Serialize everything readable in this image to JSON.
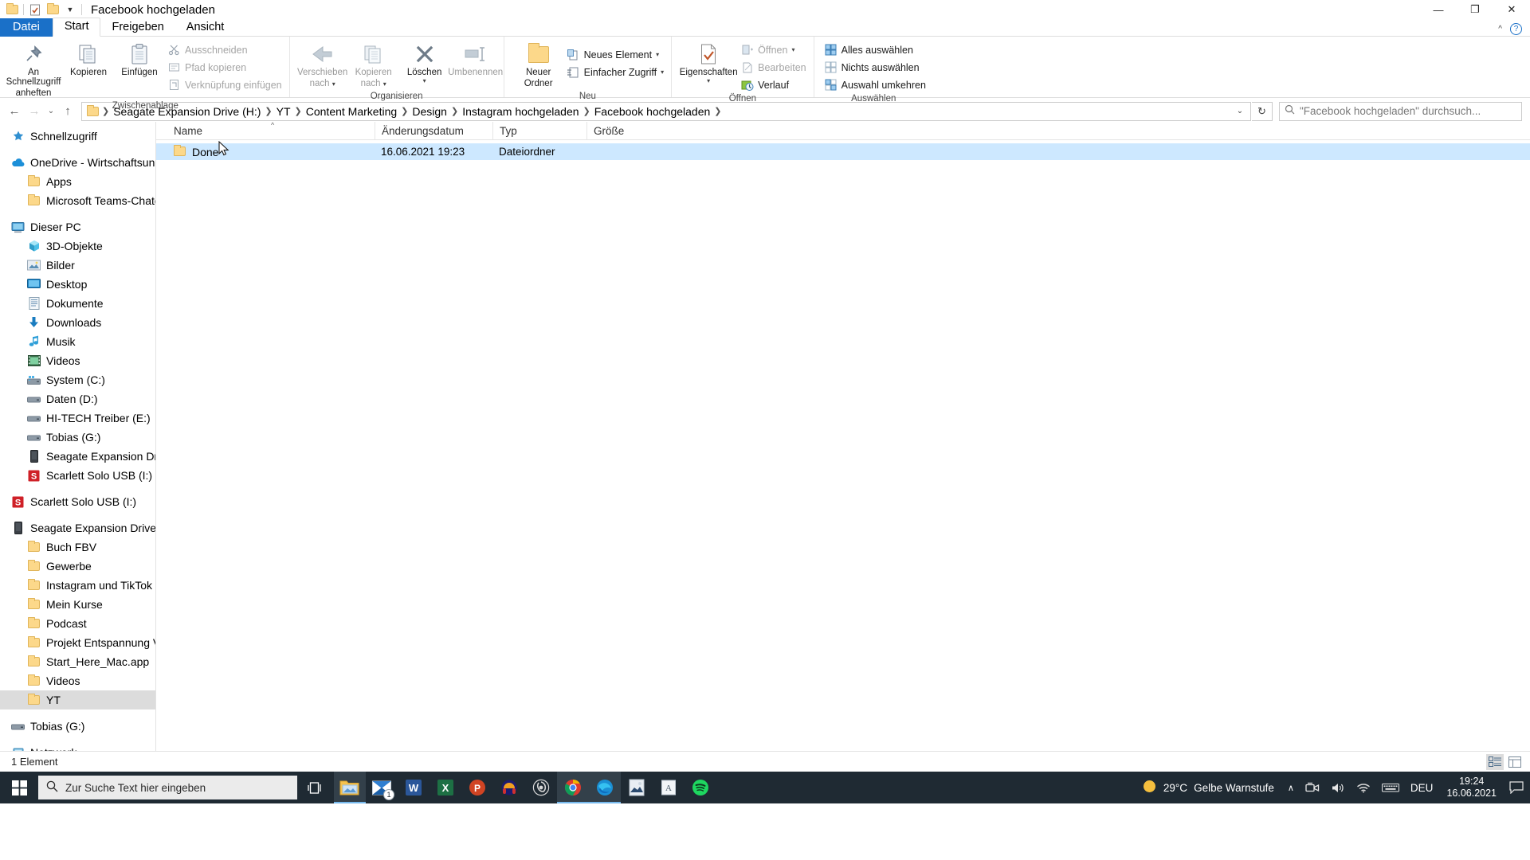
{
  "window": {
    "title": "Facebook hochgeladen",
    "quick_access_icons": [
      "folder-icon",
      "properties-icon",
      "new-folder-icon",
      "customize-chevron-icon"
    ],
    "controls": {
      "minimize": "—",
      "maximize": "❐",
      "close": "✕"
    }
  },
  "ribbon": {
    "tabs": [
      {
        "label": "Datei",
        "name": "tab-datei"
      },
      {
        "label": "Start",
        "name": "tab-start"
      },
      {
        "label": "Freigeben",
        "name": "tab-freigeben"
      },
      {
        "label": "Ansicht",
        "name": "tab-ansicht"
      }
    ],
    "active_tab": "Start",
    "collapse_icon": "chevron-up-icon",
    "help_icon": "?",
    "groups": [
      {
        "label": "Zwischenablage",
        "big_buttons": [
          {
            "label_line1": "An Schnellzugriff",
            "label_line2": "anheften",
            "icon": "pin-icon"
          },
          {
            "label_line1": "Kopieren",
            "label_line2": "",
            "icon": "copy-icon"
          },
          {
            "label_line1": "Einfügen",
            "label_line2": "",
            "icon": "paste-icon"
          }
        ],
        "small_buttons": [
          {
            "label": "Ausschneiden",
            "icon": "scissors-icon",
            "disabled": true
          },
          {
            "label": "Pfad kopieren",
            "icon": "copy-path-icon",
            "disabled": true
          },
          {
            "label": "Verknüpfung einfügen",
            "icon": "paste-shortcut-icon",
            "disabled": true
          }
        ]
      },
      {
        "label": "Organisieren",
        "big_buttons": [
          {
            "label_line1": "Verschieben",
            "label_line2": "nach",
            "icon": "move-to-icon",
            "caret": true,
            "disabled": true
          },
          {
            "label_line1": "Kopieren",
            "label_line2": "nach",
            "icon": "copy-to-icon",
            "caret": true,
            "disabled": true
          },
          {
            "label_line1": "Löschen",
            "label_line2": "",
            "icon": "delete-x-icon",
            "caret": true
          },
          {
            "label_line1": "Umbenennen",
            "label_line2": "",
            "icon": "rename-icon",
            "disabled": true
          }
        ],
        "small_buttons": []
      },
      {
        "label": "Neu",
        "big_buttons": [
          {
            "label_line1": "Neuer",
            "label_line2": "Ordner",
            "icon": "new-folder-icon"
          }
        ],
        "small_buttons": [
          {
            "label": "Neues Element",
            "icon": "new-item-icon",
            "caret": true
          },
          {
            "label": "Einfacher Zugriff",
            "icon": "easy-access-icon",
            "caret": true
          }
        ]
      },
      {
        "label": "Öffnen",
        "big_buttons": [
          {
            "label_line1": "Eigenschaften",
            "label_line2": "",
            "icon": "properties-icon",
            "caret": true
          }
        ],
        "small_buttons": [
          {
            "label": "Öffnen",
            "icon": "open-icon",
            "caret": true,
            "disabled": true
          },
          {
            "label": "Bearbeiten",
            "icon": "edit-icon",
            "disabled": true
          },
          {
            "label": "Verlauf",
            "icon": "history-icon"
          }
        ]
      },
      {
        "label": "Auswählen",
        "big_buttons": [],
        "small_buttons": [
          {
            "label": "Alles auswählen",
            "icon": "select-all-icon"
          },
          {
            "label": "Nichts auswählen",
            "icon": "select-none-icon"
          },
          {
            "label": "Auswahl umkehren",
            "icon": "invert-selection-icon"
          }
        ]
      }
    ]
  },
  "address": {
    "back_icon": "←",
    "forward_icon": "→",
    "recent_icon": "⌄",
    "up_icon": "↑",
    "breadcrumbs": [
      "Seagate Expansion Drive (H:)",
      "YT",
      "Content Marketing",
      "Design",
      "Instagram hochgeladen",
      "Facebook hochgeladen"
    ],
    "dropdown_icon": "⌄",
    "refresh_icon": "↻"
  },
  "search": {
    "icon": "search-icon",
    "value": "\"Facebook hochgeladen\" durchsuch..."
  },
  "navpane": {
    "groups": [
      {
        "items": [
          {
            "label": "Schnellzugriff",
            "icon": "star-pin-icon",
            "level": 0,
            "selected": false
          }
        ]
      },
      {
        "items": [
          {
            "label": "OneDrive - Wirtschaftsuniver",
            "icon": "onedrive-cloud-icon",
            "level": 0,
            "selected": false
          },
          {
            "label": "Apps",
            "icon": "folder-icon",
            "level": 1,
            "selected": false
          },
          {
            "label": "Microsoft Teams-Chatdatei",
            "icon": "folder-icon",
            "level": 1,
            "selected": false
          }
        ]
      },
      {
        "items": [
          {
            "label": "Dieser PC",
            "icon": "this-pc-icon",
            "level": 0,
            "selected": false
          },
          {
            "label": "3D-Objekte",
            "icon": "3d-objects-icon",
            "level": 1,
            "selected": false
          },
          {
            "label": "Bilder",
            "icon": "pictures-icon",
            "level": 1,
            "selected": false
          },
          {
            "label": "Desktop",
            "icon": "desktop-icon",
            "level": 1,
            "selected": false
          },
          {
            "label": "Dokumente",
            "icon": "documents-icon",
            "level": 1,
            "selected": false
          },
          {
            "label": "Downloads",
            "icon": "downloads-icon",
            "level": 1,
            "selected": false
          },
          {
            "label": "Musik",
            "icon": "music-icon",
            "level": 1,
            "selected": false
          },
          {
            "label": "Videos",
            "icon": "videos-icon",
            "level": 1,
            "selected": false
          },
          {
            "label": "System (C:)",
            "icon": "system-drive-icon",
            "level": 1,
            "selected": false
          },
          {
            "label": "Daten (D:)",
            "icon": "drive-icon",
            "level": 1,
            "selected": false
          },
          {
            "label": "HI-TECH Treiber (E:)",
            "icon": "drive-icon",
            "level": 1,
            "selected": false
          },
          {
            "label": "Tobias (G:)",
            "icon": "drive-icon",
            "level": 1,
            "selected": false
          },
          {
            "label": "Seagate Expansion Drive (H",
            "icon": "external-drive-icon",
            "level": 1,
            "selected": false
          },
          {
            "label": "Scarlett Solo USB (I:)",
            "icon": "scarlett-icon",
            "level": 1,
            "selected": false
          }
        ]
      },
      {
        "items": [
          {
            "label": "Scarlett Solo USB (I:)",
            "icon": "scarlett-icon",
            "level": 0,
            "selected": false
          }
        ]
      },
      {
        "items": [
          {
            "label": "Seagate Expansion Drive (H:)",
            "icon": "external-drive-icon",
            "level": 0,
            "selected": false
          },
          {
            "label": "Buch FBV",
            "icon": "folder-icon",
            "level": 1,
            "selected": false
          },
          {
            "label": "Gewerbe",
            "icon": "folder-icon",
            "level": 1,
            "selected": false
          },
          {
            "label": "Instagram und TikTok",
            "icon": "folder-icon",
            "level": 1,
            "selected": false
          },
          {
            "label": "Mein Kurse",
            "icon": "folder-icon",
            "level": 1,
            "selected": false
          },
          {
            "label": "Podcast",
            "icon": "folder-icon",
            "level": 1,
            "selected": false
          },
          {
            "label": "Projekt Entspannung Video",
            "icon": "folder-icon",
            "level": 1,
            "selected": false
          },
          {
            "label": "Start_Here_Mac.app",
            "icon": "folder-icon",
            "level": 1,
            "selected": false
          },
          {
            "label": "Videos",
            "icon": "folder-icon",
            "level": 1,
            "selected": false
          },
          {
            "label": "YT",
            "icon": "folder-icon",
            "level": 1,
            "selected": true
          }
        ]
      },
      {
        "items": [
          {
            "label": "Tobias (G:)",
            "icon": "drive-icon",
            "level": 0,
            "selected": false
          }
        ]
      },
      {
        "items": [
          {
            "label": "Netzwerk",
            "icon": "network-icon",
            "level": 0,
            "selected": false
          }
        ]
      }
    ]
  },
  "filelist": {
    "columns": [
      {
        "label": "Name",
        "key": "name",
        "sorted": true,
        "sort_dir": "asc"
      },
      {
        "label": "Änderungsdatum",
        "key": "date"
      },
      {
        "label": "Typ",
        "key": "type"
      },
      {
        "label": "Größe",
        "key": "size"
      }
    ],
    "rows": [
      {
        "name": "Done",
        "date": "16.06.2021 19:23",
        "type": "Dateiordner",
        "size": "",
        "icon": "folder-icon",
        "selected": true
      }
    ]
  },
  "statusbar": {
    "count_text": "1 Element",
    "view_details_icon": "details-view-icon",
    "view_large_icon": "large-icons-view-icon"
  },
  "taskbar": {
    "start_icon": "windows-logo-icon",
    "search_placeholder": "Zur Suche Text hier eingeben",
    "search_icon": "search-icon",
    "taskview_icon": "task-view-icon",
    "apps": [
      {
        "name": "file-explorer",
        "icon": "folder-taskbar-icon",
        "active": true,
        "badge": ""
      },
      {
        "name": "mail",
        "icon": "mail-icon",
        "active": false,
        "badge": "1"
      },
      {
        "name": "word",
        "icon": "word-icon",
        "active": false,
        "badge": ""
      },
      {
        "name": "excel",
        "icon": "excel-icon",
        "active": false,
        "badge": ""
      },
      {
        "name": "powerpoint",
        "icon": "powerpoint-icon",
        "active": false,
        "badge": ""
      },
      {
        "name": "audacity",
        "icon": "audacity-icon",
        "active": false,
        "badge": ""
      },
      {
        "name": "obs-studio",
        "icon": "obs-icon",
        "active": false,
        "badge": ""
      },
      {
        "name": "google-chrome",
        "icon": "chrome-icon",
        "active": true,
        "badge": ""
      },
      {
        "name": "microsoft-edge",
        "icon": "edge-icon",
        "active": true,
        "badge": ""
      },
      {
        "name": "photo-editor",
        "icon": "photos-icon",
        "active": false,
        "badge": ""
      },
      {
        "name": "notes",
        "icon": "notes-icon",
        "active": false,
        "badge": ""
      },
      {
        "name": "spotify",
        "icon": "spotify-icon",
        "active": false,
        "badge": ""
      }
    ],
    "tray": {
      "weather_temp": "29°C",
      "weather_text": "Gelbe Warnstufe",
      "weather_icon": "sun-icon",
      "overflow_icon": "∧",
      "icons": [
        "meet-now-icon",
        "volume-icon",
        "wifi-icon",
        "keyboard-icon"
      ],
      "language": "DEU",
      "time": "19:24",
      "date": "16.06.2021",
      "notification_icon": "notification-icon"
    }
  }
}
